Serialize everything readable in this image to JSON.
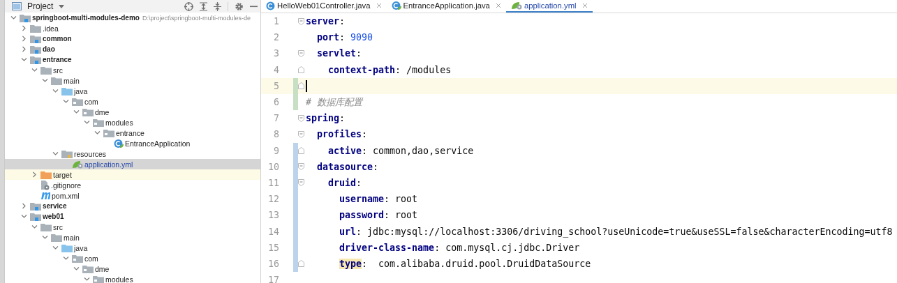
{
  "project_panel": {
    "title": "Project",
    "tree": [
      {
        "label": "springboot-multi-modules-demo",
        "kind": "module",
        "bold": true,
        "expanded": true,
        "location": "D:\\project\\springboot-multi-modules-de",
        "children": [
          {
            "label": ".idea",
            "kind": "folder",
            "expanded": false
          },
          {
            "label": "common",
            "kind": "module",
            "bold": true,
            "expanded": false
          },
          {
            "label": "dao",
            "kind": "module",
            "bold": true,
            "expanded": false
          },
          {
            "label": "entrance",
            "kind": "module",
            "bold": true,
            "expanded": true,
            "children": [
              {
                "label": "src",
                "kind": "folder",
                "expanded": true,
                "children": [
                  {
                    "label": "main",
                    "kind": "folder",
                    "expanded": true,
                    "children": [
                      {
                        "label": "java",
                        "kind": "source",
                        "expanded": true,
                        "children": [
                          {
                            "label": "com",
                            "kind": "package",
                            "expanded": true,
                            "children": [
                              {
                                "label": "dme",
                                "kind": "package",
                                "expanded": true,
                                "children": [
                                  {
                                    "label": "modules",
                                    "kind": "package",
                                    "expanded": true,
                                    "children": [
                                      {
                                        "label": "entrance",
                                        "kind": "package",
                                        "expanded": true,
                                        "children": [
                                          {
                                            "label": "EntranceApplication",
                                            "kind": "spring-class"
                                          }
                                        ]
                                      }
                                    ]
                                  }
                                ]
                              }
                            ]
                          }
                        ]
                      },
                      {
                        "label": "resources",
                        "kind": "resources",
                        "expanded": true,
                        "children": [
                          {
                            "label": "application.yml",
                            "kind": "yaml",
                            "selected": true
                          }
                        ]
                      }
                    ]
                  }
                ]
              },
              {
                "label": "target",
                "kind": "excluded",
                "expanded": false,
                "hovered": true
              },
              {
                "label": ".gitignore",
                "kind": "git-file"
              },
              {
                "label": "pom.xml",
                "kind": "maven"
              }
            ]
          },
          {
            "label": "service",
            "kind": "module",
            "bold": true,
            "expanded": false
          },
          {
            "label": "web01",
            "kind": "module",
            "bold": true,
            "expanded": true,
            "children": [
              {
                "label": "src",
                "kind": "folder",
                "expanded": true,
                "children": [
                  {
                    "label": "main",
                    "kind": "folder",
                    "expanded": true,
                    "children": [
                      {
                        "label": "java",
                        "kind": "source",
                        "expanded": true,
                        "children": [
                          {
                            "label": "com",
                            "kind": "package",
                            "expanded": true,
                            "children": [
                              {
                                "label": "dme",
                                "kind": "package",
                                "expanded": true,
                                "children": [
                                  {
                                    "label": "modules",
                                    "kind": "package",
                                    "expanded": true
                                  }
                                ]
                              }
                            ]
                          }
                        ]
                      }
                    ]
                  }
                ]
              }
            ]
          }
        ]
      }
    ]
  },
  "editor": {
    "tabs": [
      {
        "label": "HelloWeb01Controller.java",
        "kind": "class",
        "selected": false
      },
      {
        "label": "EntranceApplication.java",
        "kind": "spring-class",
        "selected": false
      },
      {
        "label": "application.yml",
        "kind": "yaml",
        "selected": true
      }
    ],
    "lines": [
      {
        "number": "1",
        "fold_start": true,
        "segments": [
          {
            "kind": "key",
            "text": "server"
          },
          {
            "kind": "plain",
            "text": ":"
          }
        ],
        "children": [
          {
            "number": "2",
            "segments": [
              {
                "kind": "key",
                "text": "port"
              },
              {
                "kind": "plain",
                "text": ": "
              },
              {
                "kind": "number",
                "text": "9090"
              }
            ]
          },
          {
            "number": "3",
            "fold_start": true,
            "segments": [
              {
                "kind": "key",
                "text": "servlet"
              },
              {
                "kind": "plain",
                "text": ":"
              }
            ],
            "children": [
              {
                "number": "4",
                "fold_end": true,
                "segments": [
                  {
                    "kind": "key",
                    "text": "context-path"
                  },
                  {
                    "kind": "plain",
                    "text": ": /modules"
                  }
                ]
              }
            ]
          }
        ]
      },
      {
        "number": "5",
        "fold_end": true,
        "current": true,
        "added": true
      },
      {
        "number": "6",
        "added": true,
        "segments": [
          {
            "kind": "comment",
            "text": "# 数据库配置"
          }
        ]
      },
      {
        "number": "7",
        "fold_start": true,
        "segments": [
          {
            "kind": "key",
            "text": "spring"
          },
          {
            "kind": "plain",
            "text": ":"
          }
        ],
        "children": [
          {
            "number": "8",
            "fold_start": true,
            "segments": [
              {
                "kind": "key",
                "text": "profiles"
              },
              {
                "kind": "plain",
                "text": ":"
              }
            ],
            "children": [
              {
                "number": "9",
                "fold_end": true,
                "modified": true,
                "segments": [
                  {
                    "kind": "key",
                    "text": "active"
                  },
                  {
                    "kind": "plain",
                    "text": ": common,dao,service"
                  }
                ]
              }
            ]
          },
          {
            "number": "10",
            "fold_start": true,
            "modified": true,
            "segments": [
              {
                "kind": "key",
                "text": "datasource"
              },
              {
                "kind": "plain",
                "text": ":"
              }
            ],
            "children": [
              {
                "number": "11",
                "fold_start": true,
                "modified": true,
                "segments": [
                  {
                    "kind": "key",
                    "text": "druid"
                  },
                  {
                    "kind": "plain",
                    "text": ":"
                  }
                ],
                "children": [
                  {
                    "number": "12",
                    "modified": true,
                    "segments": [
                      {
                        "kind": "key",
                        "text": "username"
                      },
                      {
                        "kind": "plain",
                        "text": ": root"
                      }
                    ]
                  },
                  {
                    "number": "13",
                    "modified": true,
                    "segments": [
                      {
                        "kind": "key",
                        "text": "password"
                      },
                      {
                        "kind": "plain",
                        "text": ": root"
                      }
                    ]
                  },
                  {
                    "number": "14",
                    "modified": true,
                    "segments": [
                      {
                        "kind": "key",
                        "text": "url"
                      },
                      {
                        "kind": "plain",
                        "text": ": jdbc:mysql://localhost:3306/driving_school?useUnicode=true&useSSL=false&characterEncoding=utf8"
                      }
                    ]
                  },
                  {
                    "number": "15",
                    "modified": true,
                    "segments": [
                      {
                        "kind": "key",
                        "text": "driver-class-name"
                      },
                      {
                        "kind": "plain",
                        "text": ": com.mysql.cj.jdbc.Driver"
                      }
                    ]
                  },
                  {
                    "number": "16",
                    "fold_end": true,
                    "modified": true,
                    "segments": [
                      {
                        "kind": "key-highlighted",
                        "text": "type"
                      },
                      {
                        "kind": "plain",
                        "text": ":  com.alibaba.druid.pool.DruidDataSource"
                      }
                    ]
                  }
                ]
              }
            ]
          }
        ]
      },
      {
        "number": "17"
      }
    ]
  }
}
